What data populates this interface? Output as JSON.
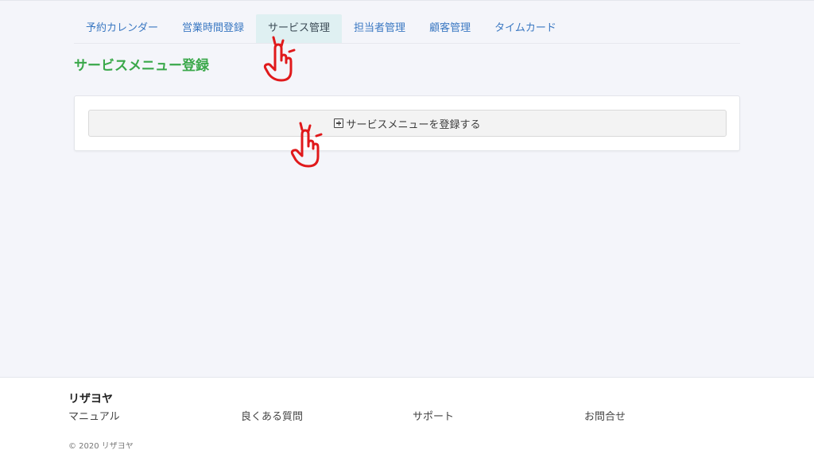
{
  "nav": {
    "tabs": [
      {
        "label": "予約カレンダー"
      },
      {
        "label": "営業時間登録"
      },
      {
        "label": "サービス管理",
        "active": true
      },
      {
        "label": "担当者管理"
      },
      {
        "label": "顧客管理"
      },
      {
        "label": "タイムカード"
      }
    ]
  },
  "main": {
    "title": "サービスメニュー登録",
    "register_button_label": "サービスメニューを登録する",
    "register_button_icon": "plus-square-icon"
  },
  "annotations": {
    "icon": "pointing-hand-icon",
    "color": "#e0191b"
  },
  "footer": {
    "brand": "リザヨヤ",
    "links": [
      "マニュアル",
      "良くある質問",
      "サポート",
      "お問合せ"
    ],
    "copyright": "© 2020 リザヨヤ"
  },
  "colors": {
    "accent_green": "#3aa84a",
    "tab_link": "#3a78c2",
    "active_tab_bg": "#dff0f2",
    "main_bg": "#f4f5fa"
  }
}
